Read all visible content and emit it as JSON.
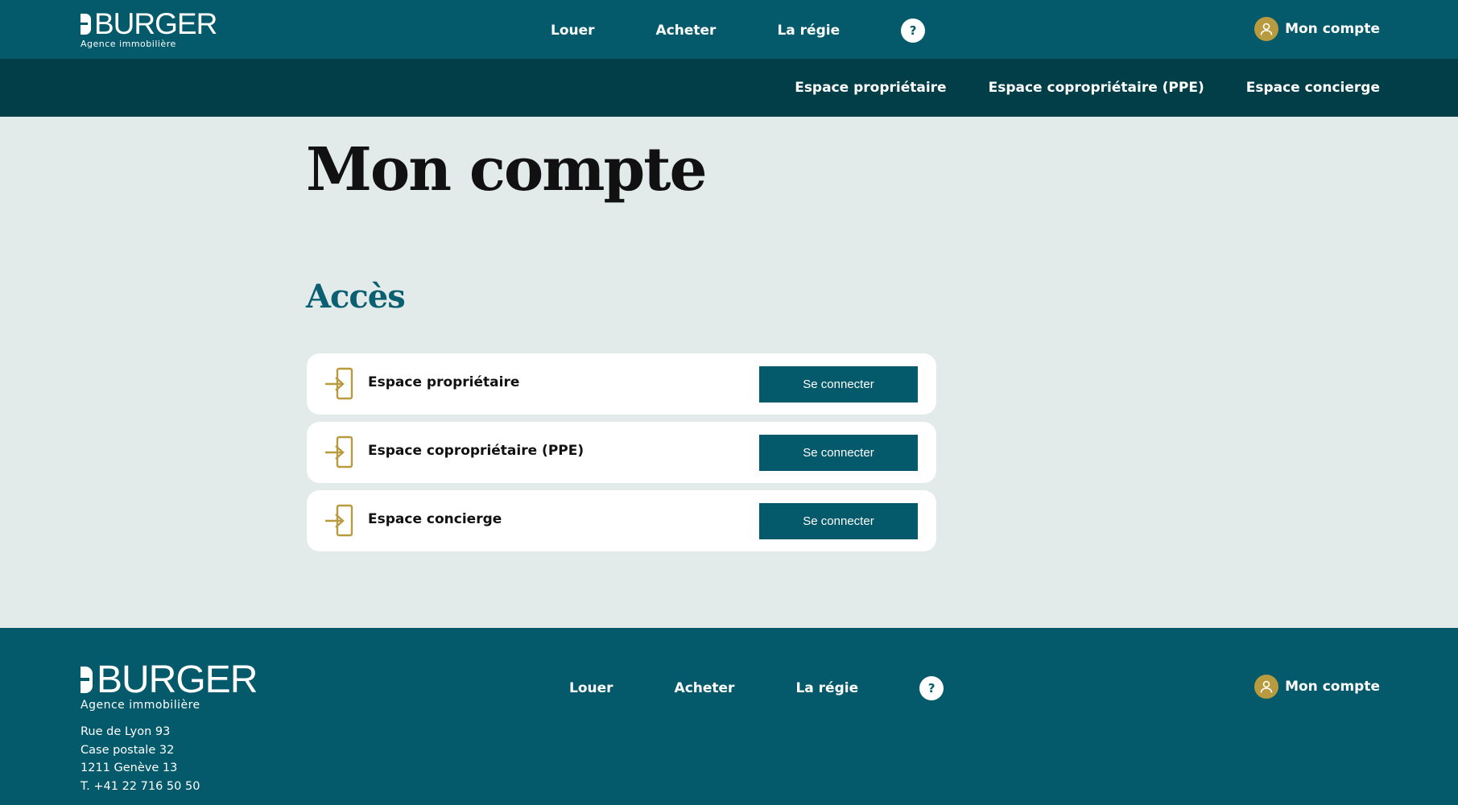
{
  "brand": {
    "name": "BURGER",
    "tagline": "Agence immobilière"
  },
  "header": {
    "nav": [
      "Louer",
      "Acheter",
      "La régie"
    ],
    "help": "?",
    "account": "Mon compte"
  },
  "subnav": [
    "Espace propriétaire",
    "Espace copropriétaire (PPE)",
    "Espace concierge"
  ],
  "main": {
    "title": "Mon compte",
    "section_title": "Accès",
    "access": [
      {
        "label": "Espace propriétaire",
        "button": "Se connecter",
        "icon": "login-icon"
      },
      {
        "label": "Espace copropriétaire (PPE)",
        "button": "Se connecter",
        "icon": "login-icon"
      },
      {
        "label": "Espace concierge",
        "button": "Se connecter",
        "icon": "login-icon"
      }
    ]
  },
  "footer": {
    "nav": [
      "Louer",
      "Acheter",
      "La régie"
    ],
    "help": "?",
    "account": "Mon compte",
    "address": [
      "Rue de Lyon 93",
      "Case postale 32",
      "1211 Genève 13",
      "T. +41 22 716 50 50"
    ]
  },
  "colors": {
    "primary": "#045a6b",
    "dark": "#023e48",
    "accent": "#b89b3f",
    "background": "#e3eaea"
  }
}
